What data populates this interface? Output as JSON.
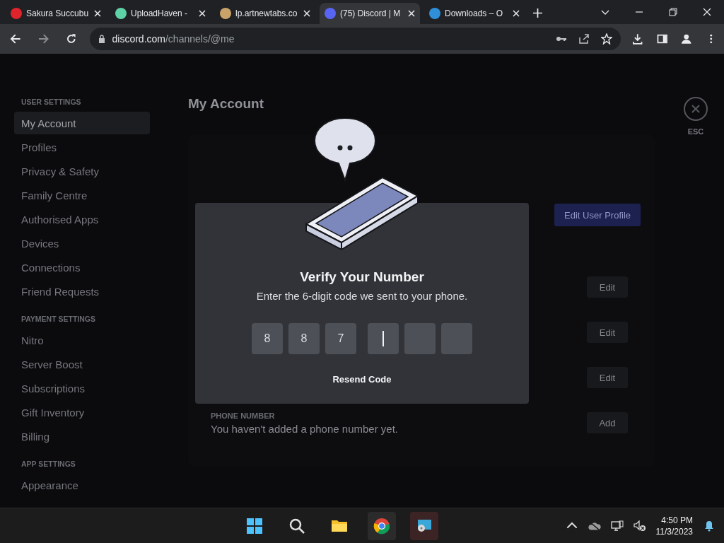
{
  "browser": {
    "tabs": [
      {
        "title": "Sakura Succubu",
        "selected": false,
        "color": "#e0242c"
      },
      {
        "title": "UploadHaven - ",
        "selected": false,
        "color": "#5fd3a8"
      },
      {
        "title": "lp.artnewtabs.co",
        "selected": false,
        "color": "#c9a36a"
      },
      {
        "title": "(75) Discord | M",
        "selected": true,
        "color": "#5865f2"
      },
      {
        "title": "Downloads – O",
        "selected": false,
        "color": "#2f8fd8"
      }
    ],
    "address": {
      "host": "discord.com",
      "path": "/channels/@me"
    }
  },
  "sidebar": {
    "groups": [
      {
        "heading": "USER SETTINGS",
        "items": [
          {
            "label": "My Account",
            "selected": true
          },
          {
            "label": "Profiles",
            "selected": false
          },
          {
            "label": "Privacy & Safety",
            "selected": false
          },
          {
            "label": "Family Centre",
            "selected": false
          },
          {
            "label": "Authorised Apps",
            "selected": false
          },
          {
            "label": "Devices",
            "selected": false
          },
          {
            "label": "Connections",
            "selected": false
          },
          {
            "label": "Friend Requests",
            "selected": false
          }
        ]
      },
      {
        "heading": "PAYMENT SETTINGS",
        "items": [
          {
            "label": "Nitro",
            "selected": false
          },
          {
            "label": "Server Boost",
            "selected": false
          },
          {
            "label": "Subscriptions",
            "selected": false
          },
          {
            "label": "Gift Inventory",
            "selected": false
          },
          {
            "label": "Billing",
            "selected": false
          }
        ]
      },
      {
        "heading": "APP SETTINGS",
        "items": [
          {
            "label": "Appearance",
            "selected": false
          }
        ]
      }
    ]
  },
  "main": {
    "title": "My Account",
    "close_label": "ESC",
    "profile_button": "Edit User Profile",
    "rows": [
      {
        "button": "Edit"
      },
      {
        "button": "Edit"
      },
      {
        "button": "Edit"
      },
      {
        "label": "PHONE NUMBER",
        "value": "You haven't added a phone number yet.",
        "button": "Add"
      }
    ]
  },
  "modal": {
    "title": "Verify Your Number",
    "subtitle": "Enter the 6-digit code we sent to your phone.",
    "digits": [
      {
        "value": "8",
        "focused": false
      },
      {
        "value": "8",
        "focused": false
      },
      {
        "value": "7",
        "focused": false
      },
      {
        "focused": true
      },
      {
        "focused": false
      },
      {
        "focused": false
      }
    ],
    "resend": "Resend Code"
  },
  "taskbar": {
    "time": "4:50 PM",
    "date": "11/3/2023"
  }
}
